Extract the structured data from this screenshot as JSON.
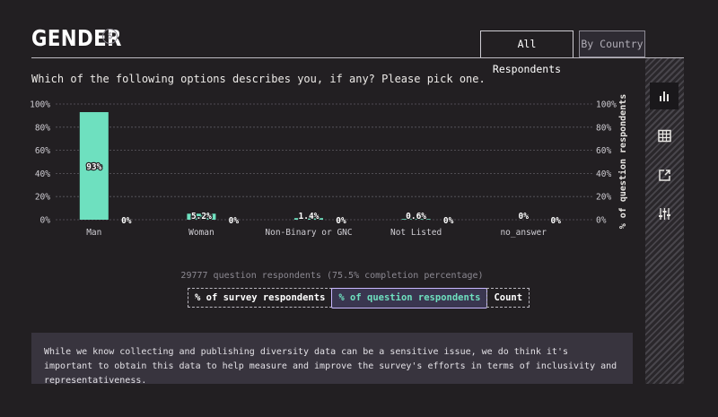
{
  "header": {
    "title": "GENDER",
    "icon": "dollar-circle-icon"
  },
  "tabs": [
    {
      "label": "All Respondents",
      "active": true
    },
    {
      "label": "By Country",
      "active": false
    }
  ],
  "question": "Which of the following options describes you, if any? Please pick one.",
  "sidebar": {
    "buttons": [
      {
        "icon": "bar-chart-icon",
        "active": true
      },
      {
        "icon": "table-icon",
        "active": false
      },
      {
        "icon": "share-icon",
        "active": false
      },
      {
        "icon": "sliders-icon",
        "active": false
      }
    ]
  },
  "chart_data": {
    "type": "bar",
    "categories": [
      "Man",
      "Woman",
      "Non-Binary or GNC",
      "Not Listed",
      "no_answer"
    ],
    "series": [
      {
        "values": [
          93,
          5.2,
          1.4,
          0.6,
          0
        ],
        "labels": [
          "93%",
          "5.2%",
          "1.4%",
          "0.6%",
          "0%"
        ]
      },
      {
        "values": [
          0,
          0,
          0,
          0,
          0
        ],
        "labels": [
          "0%",
          "0%",
          "0%",
          "0%",
          "0%"
        ]
      }
    ],
    "ylim": [
      0,
      100
    ],
    "yticks": [
      "0%",
      "20%",
      "40%",
      "60%",
      "80%",
      "100%"
    ],
    "right_axis_label": "% of question respondents",
    "bar_color": "#6ee0bf",
    "grid": true
  },
  "respondents_text": "29777 question respondents (75.5% completion percentage)",
  "toggles": [
    {
      "label": "% of survey respondents",
      "selected": false
    },
    {
      "label": "% of question respondents",
      "selected": true
    },
    {
      "label": "Count",
      "selected": false
    }
  ],
  "note": "While we know collecting and publishing diversity data can be a sensitive issue, we do think it's important to obtain this data to help measure and improve the survey's efforts in terms of inclusivity and representativeness."
}
